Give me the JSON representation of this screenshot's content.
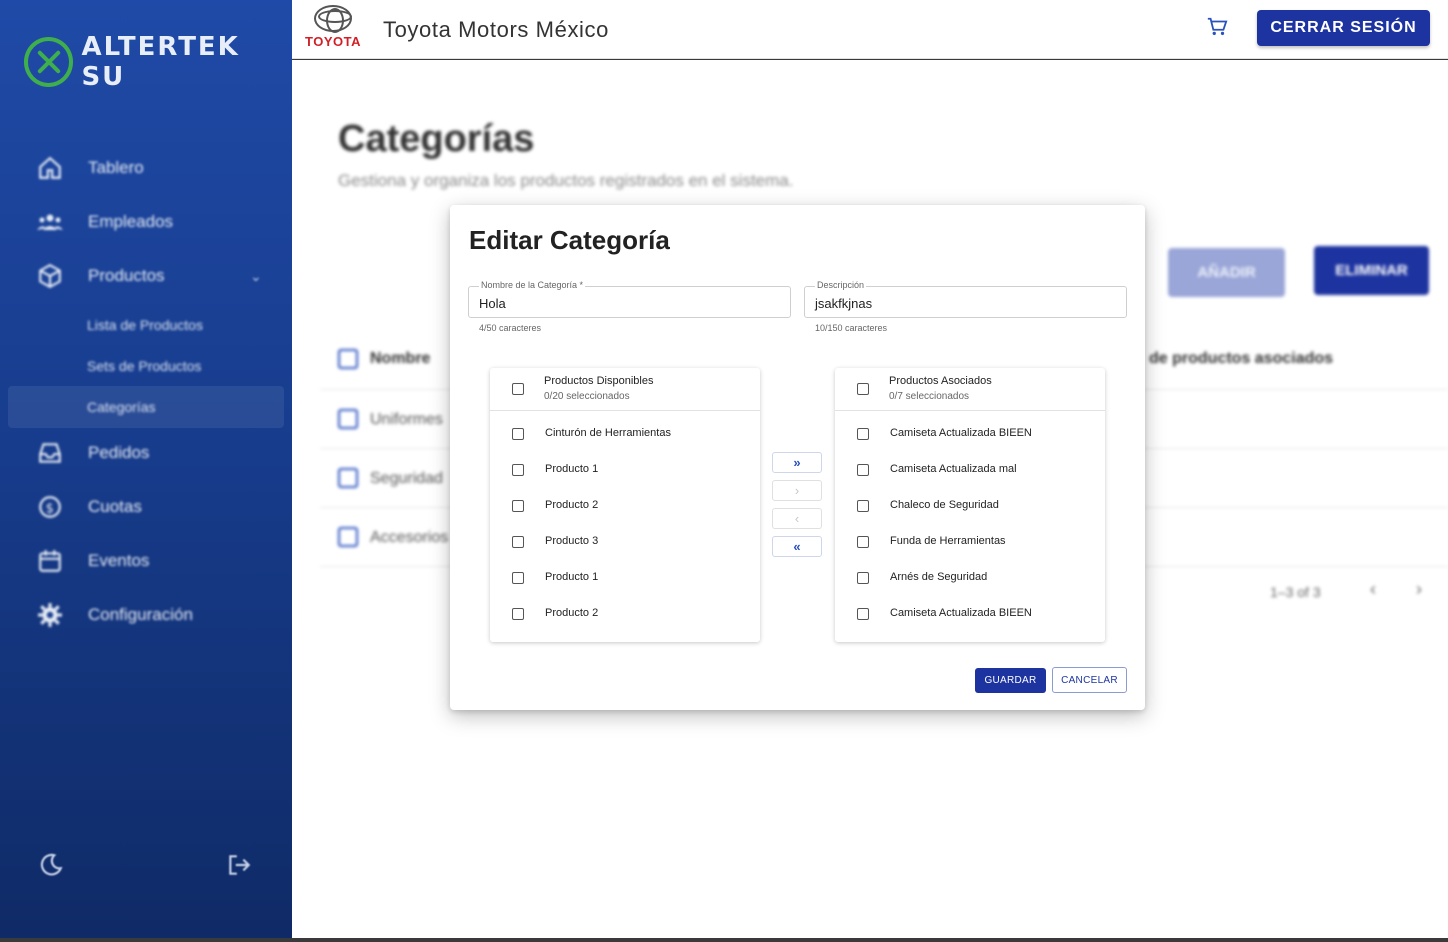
{
  "sidebar": {
    "brand": "ALTERTEK SU",
    "items": [
      {
        "label": "Tablero"
      },
      {
        "label": "Empleados"
      },
      {
        "label": "Productos"
      },
      {
        "label": "Pedidos"
      },
      {
        "label": "Cuotas"
      },
      {
        "label": "Eventos"
      },
      {
        "label": "Configuración"
      }
    ],
    "subitems": [
      {
        "label": "Lista de Productos"
      },
      {
        "label": "Sets de Productos"
      },
      {
        "label": "Categorías"
      }
    ]
  },
  "topbar": {
    "brand_word": "TOYOTA",
    "company": "Toyota Motors México",
    "logout_label": "CERRAR SESIÓN"
  },
  "page": {
    "title": "Categorías",
    "subtitle": "Gestiona y organiza los productos registrados en el sistema.",
    "add_label": "AÑADIR",
    "delete_label": "ELIMINAR",
    "table": {
      "col_name": "Nombre",
      "col_count": "de productos asociados",
      "rows": [
        {
          "name": "Uniformes"
        },
        {
          "name": "Seguridad"
        },
        {
          "name": "Accesorios"
        }
      ]
    },
    "pagination": "1–3 of 3"
  },
  "modal": {
    "title": "Editar Categoría",
    "name_field": {
      "label": "Nombre de la Categoría *",
      "value": "Hola",
      "help": "4/50 caracteres"
    },
    "desc_field": {
      "label": "Descripción",
      "value": "jsakfkjnas",
      "help": "10/150 caracteres"
    },
    "available": {
      "title": "Productos Disponibles",
      "count": "0/20 seleccionados",
      "items": [
        "Cinturón de Herramientas",
        "Producto 1",
        "Producto 2",
        "Producto 3",
        "Producto 1",
        "Producto 2"
      ]
    },
    "associated": {
      "title": "Productos Asociados",
      "count": "0/7 seleccionados",
      "items": [
        "Camiseta Actualizada BIEEN",
        "Camiseta Actualizada mal",
        "Chaleco de Seguridad",
        "Funda de Herramientas",
        "Arnés de Seguridad",
        "Camiseta Actualizada BIEEN"
      ]
    },
    "transfer": {
      "all_right": "»",
      "right": "›",
      "left": "‹",
      "all_left": "«"
    },
    "save_label": "GUARDAR",
    "cancel_label": "CANCELAR"
  },
  "colors": {
    "primary": "#1d33a0",
    "sidebar": "#1f4aa7",
    "toyota_red": "#d21f26",
    "brand_green": "#3fae4c"
  }
}
